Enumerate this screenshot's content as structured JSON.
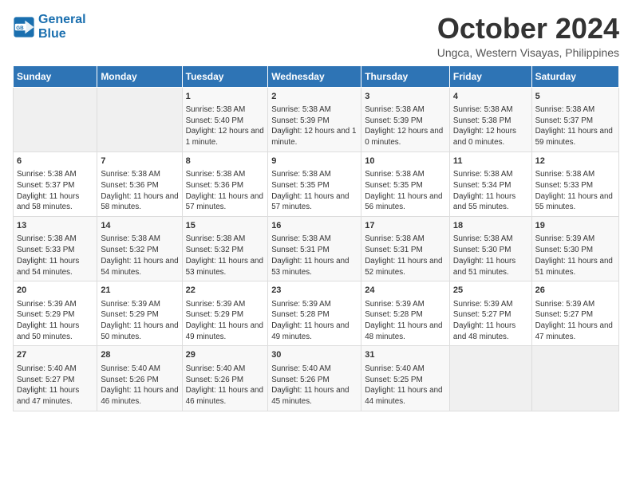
{
  "logo": {
    "line1": "General",
    "line2": "Blue"
  },
  "title": "October 2024",
  "location": "Ungca, Western Visayas, Philippines",
  "headers": [
    "Sunday",
    "Monday",
    "Tuesday",
    "Wednesday",
    "Thursday",
    "Friday",
    "Saturday"
  ],
  "weeks": [
    [
      {
        "day": "",
        "info": ""
      },
      {
        "day": "",
        "info": ""
      },
      {
        "day": "1",
        "info": "Sunrise: 5:38 AM\nSunset: 5:40 PM\nDaylight: 12 hours and 1 minute."
      },
      {
        "day": "2",
        "info": "Sunrise: 5:38 AM\nSunset: 5:39 PM\nDaylight: 12 hours and 1 minute."
      },
      {
        "day": "3",
        "info": "Sunrise: 5:38 AM\nSunset: 5:39 PM\nDaylight: 12 hours and 0 minutes."
      },
      {
        "day": "4",
        "info": "Sunrise: 5:38 AM\nSunset: 5:38 PM\nDaylight: 12 hours and 0 minutes."
      },
      {
        "day": "5",
        "info": "Sunrise: 5:38 AM\nSunset: 5:37 PM\nDaylight: 11 hours and 59 minutes."
      }
    ],
    [
      {
        "day": "6",
        "info": "Sunrise: 5:38 AM\nSunset: 5:37 PM\nDaylight: 11 hours and 58 minutes."
      },
      {
        "day": "7",
        "info": "Sunrise: 5:38 AM\nSunset: 5:36 PM\nDaylight: 11 hours and 58 minutes."
      },
      {
        "day": "8",
        "info": "Sunrise: 5:38 AM\nSunset: 5:36 PM\nDaylight: 11 hours and 57 minutes."
      },
      {
        "day": "9",
        "info": "Sunrise: 5:38 AM\nSunset: 5:35 PM\nDaylight: 11 hours and 57 minutes."
      },
      {
        "day": "10",
        "info": "Sunrise: 5:38 AM\nSunset: 5:35 PM\nDaylight: 11 hours and 56 minutes."
      },
      {
        "day": "11",
        "info": "Sunrise: 5:38 AM\nSunset: 5:34 PM\nDaylight: 11 hours and 55 minutes."
      },
      {
        "day": "12",
        "info": "Sunrise: 5:38 AM\nSunset: 5:33 PM\nDaylight: 11 hours and 55 minutes."
      }
    ],
    [
      {
        "day": "13",
        "info": "Sunrise: 5:38 AM\nSunset: 5:33 PM\nDaylight: 11 hours and 54 minutes."
      },
      {
        "day": "14",
        "info": "Sunrise: 5:38 AM\nSunset: 5:32 PM\nDaylight: 11 hours and 54 minutes."
      },
      {
        "day": "15",
        "info": "Sunrise: 5:38 AM\nSunset: 5:32 PM\nDaylight: 11 hours and 53 minutes."
      },
      {
        "day": "16",
        "info": "Sunrise: 5:38 AM\nSunset: 5:31 PM\nDaylight: 11 hours and 53 minutes."
      },
      {
        "day": "17",
        "info": "Sunrise: 5:38 AM\nSunset: 5:31 PM\nDaylight: 11 hours and 52 minutes."
      },
      {
        "day": "18",
        "info": "Sunrise: 5:38 AM\nSunset: 5:30 PM\nDaylight: 11 hours and 51 minutes."
      },
      {
        "day": "19",
        "info": "Sunrise: 5:39 AM\nSunset: 5:30 PM\nDaylight: 11 hours and 51 minutes."
      }
    ],
    [
      {
        "day": "20",
        "info": "Sunrise: 5:39 AM\nSunset: 5:29 PM\nDaylight: 11 hours and 50 minutes."
      },
      {
        "day": "21",
        "info": "Sunrise: 5:39 AM\nSunset: 5:29 PM\nDaylight: 11 hours and 50 minutes."
      },
      {
        "day": "22",
        "info": "Sunrise: 5:39 AM\nSunset: 5:29 PM\nDaylight: 11 hours and 49 minutes."
      },
      {
        "day": "23",
        "info": "Sunrise: 5:39 AM\nSunset: 5:28 PM\nDaylight: 11 hours and 49 minutes."
      },
      {
        "day": "24",
        "info": "Sunrise: 5:39 AM\nSunset: 5:28 PM\nDaylight: 11 hours and 48 minutes."
      },
      {
        "day": "25",
        "info": "Sunrise: 5:39 AM\nSunset: 5:27 PM\nDaylight: 11 hours and 48 minutes."
      },
      {
        "day": "26",
        "info": "Sunrise: 5:39 AM\nSunset: 5:27 PM\nDaylight: 11 hours and 47 minutes."
      }
    ],
    [
      {
        "day": "27",
        "info": "Sunrise: 5:40 AM\nSunset: 5:27 PM\nDaylight: 11 hours and 47 minutes."
      },
      {
        "day": "28",
        "info": "Sunrise: 5:40 AM\nSunset: 5:26 PM\nDaylight: 11 hours and 46 minutes."
      },
      {
        "day": "29",
        "info": "Sunrise: 5:40 AM\nSunset: 5:26 PM\nDaylight: 11 hours and 46 minutes."
      },
      {
        "day": "30",
        "info": "Sunrise: 5:40 AM\nSunset: 5:26 PM\nDaylight: 11 hours and 45 minutes."
      },
      {
        "day": "31",
        "info": "Sunrise: 5:40 AM\nSunset: 5:25 PM\nDaylight: 11 hours and 44 minutes."
      },
      {
        "day": "",
        "info": ""
      },
      {
        "day": "",
        "info": ""
      }
    ]
  ]
}
